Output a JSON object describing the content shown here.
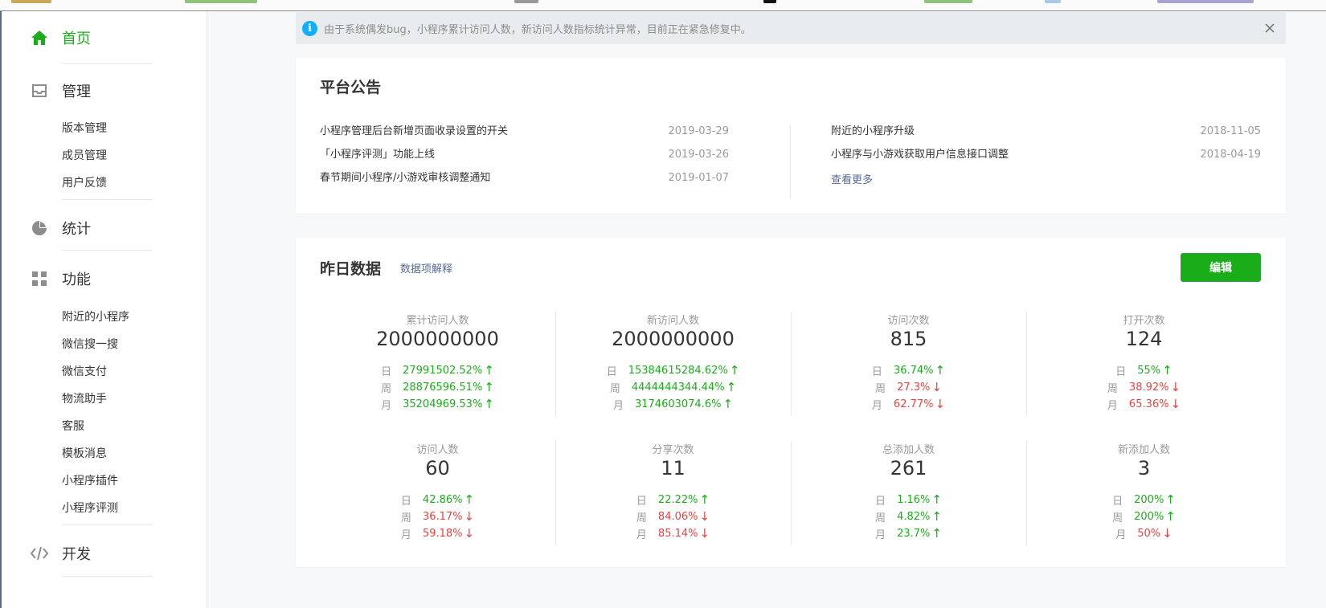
{
  "colors": {
    "accent": "#1aad19",
    "up": "#1aad19",
    "down": "#e64340",
    "link": "#576b95",
    "info": "#10aeff"
  },
  "sidebar": {
    "home": {
      "label": "首页",
      "icon": "home-icon"
    },
    "manage": {
      "label": "管理",
      "icon": "inbox-icon",
      "items": [
        "版本管理",
        "成员管理",
        "用户反馈"
      ]
    },
    "stats": {
      "label": "统计",
      "icon": "pie-chart-icon"
    },
    "features": {
      "label": "功能",
      "icon": "grid-icon",
      "items": [
        "附近的小程序",
        "微信搜一搜",
        "微信支付",
        "物流助手",
        "客服",
        "模板消息",
        "小程序插件",
        "小程序评测"
      ]
    },
    "dev": {
      "label": "开发",
      "icon": "code-icon"
    }
  },
  "notice": {
    "text": "由于系统偶发bug，小程序累计访问人数，新访问人数指标统计异常，目前正在紧急修复中。"
  },
  "announcements": {
    "title": "平台公告",
    "left": [
      {
        "title": "小程序管理后台新增页面收录设置的开关",
        "date": "2019-03-29"
      },
      {
        "title": "「小程序评测」功能上线",
        "date": "2019-03-26"
      },
      {
        "title": "春节期间小程序/小游戏审核调整通知",
        "date": "2019-01-07"
      }
    ],
    "right": [
      {
        "title": "附近的小程序升级",
        "date": "2018-11-05"
      },
      {
        "title": "小程序与小游戏获取用户信息接口调整",
        "date": "2018-04-19"
      }
    ],
    "see_more": "查看更多"
  },
  "yesterday": {
    "title": "昨日数据",
    "explain_link": "数据项解释",
    "edit_label": "编辑",
    "period_labels": {
      "day": "日",
      "week": "周",
      "month": "月"
    },
    "stats": [
      {
        "label": "累计访问人数",
        "value": "2000000000",
        "day": "27991502.52%",
        "day_dir": "up",
        "week": "28876596.51%",
        "week_dir": "up",
        "month": "35204969.53%",
        "month_dir": "up"
      },
      {
        "label": "新访问人数",
        "value": "2000000000",
        "day": "15384615284.62%",
        "day_dir": "up",
        "week": "4444444344.44%",
        "week_dir": "up",
        "month": "3174603074.6%",
        "month_dir": "up"
      },
      {
        "label": "访问次数",
        "value": "815",
        "day": "36.74%",
        "day_dir": "up",
        "week": "27.3%",
        "week_dir": "down",
        "month": "62.77%",
        "month_dir": "down"
      },
      {
        "label": "打开次数",
        "value": "124",
        "day": "55%",
        "day_dir": "up",
        "week": "38.92%",
        "week_dir": "down",
        "month": "65.36%",
        "month_dir": "down"
      },
      {
        "label": "访问人数",
        "value": "60",
        "day": "42.86%",
        "day_dir": "up",
        "week": "36.17%",
        "week_dir": "down",
        "month": "59.18%",
        "month_dir": "down"
      },
      {
        "label": "分享次数",
        "value": "11",
        "day": "22.22%",
        "day_dir": "up",
        "week": "84.06%",
        "week_dir": "down",
        "month": "85.14%",
        "month_dir": "down"
      },
      {
        "label": "总添加人数",
        "value": "261",
        "day": "1.16%",
        "day_dir": "up",
        "week": "4.82%",
        "week_dir": "up",
        "month": "23.7%",
        "month_dir": "up"
      },
      {
        "label": "新添加人数",
        "value": "3",
        "day": "200%",
        "day_dir": "up",
        "week": "200%",
        "week_dir": "up",
        "month": "50%",
        "month_dir": "down"
      }
    ]
  }
}
